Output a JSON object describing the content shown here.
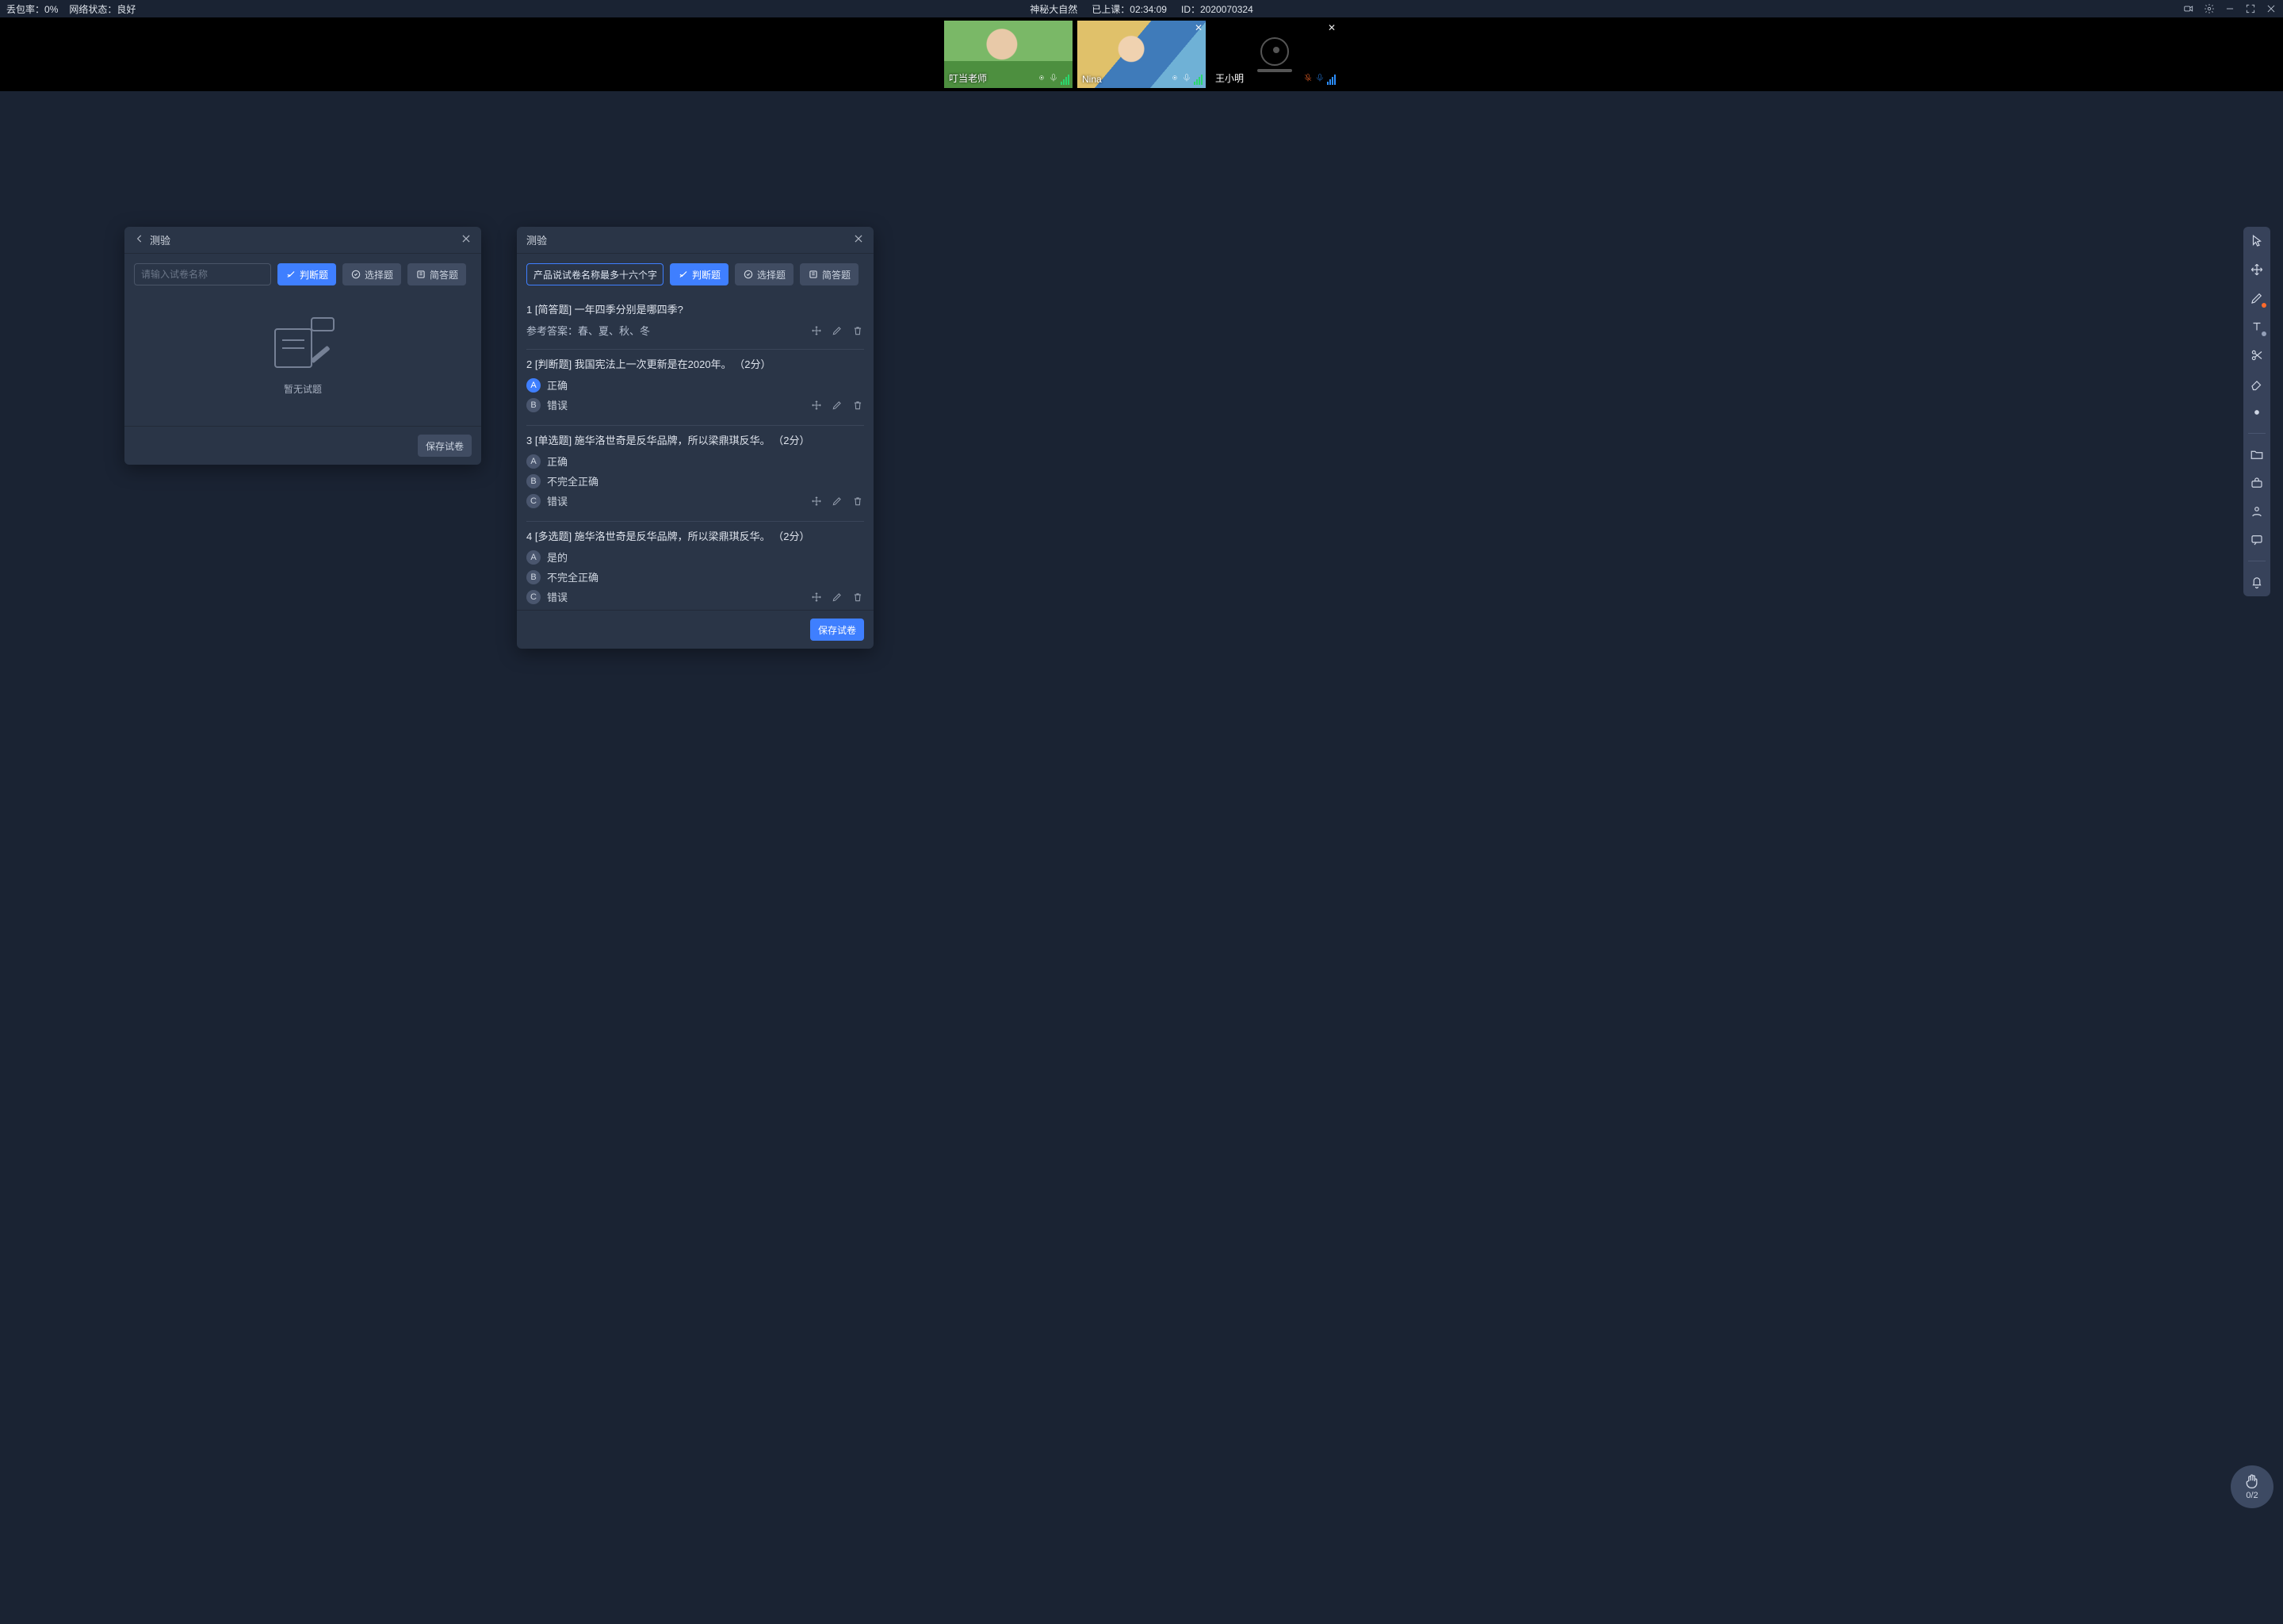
{
  "topbar": {
    "packet_loss_label": "丢包率：",
    "packet_loss_value": "0%",
    "net_label": "网络状态：",
    "net_value": "良好",
    "course_title": "神秘大自然",
    "elapsed_label": "已上课：",
    "elapsed_value": "02:34:09",
    "id_label": "ID：",
    "id_value": "2020070324"
  },
  "videos": [
    {
      "name": "叮当老师",
      "camera_off": false,
      "closable": false,
      "mic_muted": false,
      "bars_color": "#2bd66e"
    },
    {
      "name": "Nina",
      "camera_off": false,
      "closable": true,
      "mic_muted": false,
      "bars_color": "#2bd66e"
    },
    {
      "name": "王小明",
      "camera_off": true,
      "closable": true,
      "mic_muted": true,
      "bars_color": "#2b8dff"
    }
  ],
  "panel_left": {
    "title": "测验",
    "placeholder": "请输入试卷名称",
    "btn_judge": "判断题",
    "btn_choice": "选择题",
    "btn_short": "简答题",
    "empty_text": "暂无试题",
    "save": "保存试卷"
  },
  "panel_right": {
    "title": "测验",
    "name_value": "产品说试卷名称最多十六个字",
    "btn_judge": "判断题",
    "btn_choice": "选择题",
    "btn_short": "简答题",
    "save": "保存试卷",
    "questions": [
      {
        "num": "1",
        "tag": "[简答题]",
        "text": "一年四季分别是哪四季?",
        "ref_label": "参考答案：",
        "ref_value": "春、夏、秋、冬",
        "options": []
      },
      {
        "num": "2",
        "tag": "[判断题]",
        "text": "我国宪法上一次更新是在2020年。",
        "score": "（2分）",
        "options": [
          {
            "letter": "A",
            "text": "正确",
            "selected": true
          },
          {
            "letter": "B",
            "text": "错误",
            "selected": false
          }
        ]
      },
      {
        "num": "3",
        "tag": "[单选题]",
        "text": "施华洛世奇是反华品牌，所以梁鼎琪反华。",
        "score": "（2分）",
        "options": [
          {
            "letter": "A",
            "text": "正确",
            "selected": false
          },
          {
            "letter": "B",
            "text": "不完全正确",
            "selected": false
          },
          {
            "letter": "C",
            "text": "错误",
            "selected": false
          }
        ]
      },
      {
        "num": "4",
        "tag": "[多选题]",
        "text": "施华洛世奇是反华品牌，所以梁鼎琪反华。",
        "score": "（2分）",
        "options": [
          {
            "letter": "A",
            "text": "是的",
            "selected": false
          },
          {
            "letter": "B",
            "text": "不完全正确",
            "selected": false
          },
          {
            "letter": "C",
            "text": "错误",
            "selected": false
          }
        ]
      }
    ]
  },
  "sidebar": {
    "pen_dot_color": "#ff6a2b",
    "text_dot_color": "#94a0b8"
  },
  "hand": {
    "count": "0/2"
  }
}
